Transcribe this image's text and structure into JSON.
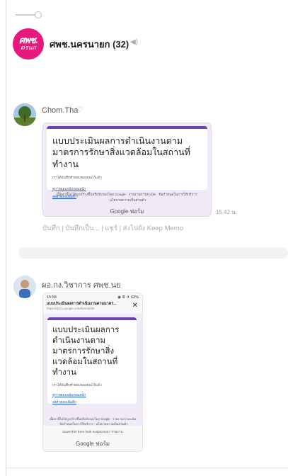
{
  "header": {
    "group_name": "ศพช.นครนายก (32)",
    "avatar_line1": "ศพช.",
    "avatar_line2": "ตรนก"
  },
  "messages": [
    {
      "sender": "Chom.Tha",
      "form_title": "แบบประเมินผลการดำเนินงานตามมาตรการรักษาสิ่งแวดล้อมในสถานที่ทำงาน",
      "note": "เราได้บันทึกคำตอบของคุณไว้แล้ว",
      "link1": "ดูการตอบกลับก่อนหน้า",
      "link2": "ส่งคำตอบเพิ่มอีก",
      "footer": "เนื้อหานี้ไม่ได้ถูกสร้างขึ้นหรือรับรองโดย Google · รายงานการละเมิด · ข้อกำหนดในการให้บริการ · นโยบายความเป็นส่วนตัว",
      "brand": "Google ฟอร์ม",
      "time": "15.42 น.",
      "actions": "บันทึก | บันทึกเป็น... | แชร์ | ส่งไปยัง Keep Memo"
    },
    {
      "sender": "ผอ.กง.วิชาการ ศพช.นย",
      "status_time": "15:58",
      "status_icons": "◉ ⚙ ✈ 63%",
      "url_title": "แบบประเมินผลการดำเนินงานตามมาตร...",
      "url_sub": "https://docs.google.com/forms/d/e",
      "form_title": "แบบประเมินผลการดำเนินงานตามมาตรการรักษาสิ่งแวดล้อมในสถานที่ทำงาน",
      "note": "เราได้บันทึกคำตอบของคุณไว้แล้ว",
      "link1": "ดูการตอบกลับก่อนหน้า",
      "link2": "ส่งคำตอบเพิ่มอีก",
      "footer": "เนื้อหานี้ไม่ได้ถูกสร้างขึ้นหรือรับรองโดย Google · รายงานการละเมิด · ข้อกำหนดในการให้บริการ · นโยบายความเป็นส่วนตัว",
      "suspicious": "Does this form look suspicious? รายงาน",
      "brand": "Google ฟอร์ม"
    }
  ],
  "colors": {
    "accent": "#6a3fb3",
    "card_bg": "#efeaf6",
    "group_avatar": "#e8197c"
  }
}
